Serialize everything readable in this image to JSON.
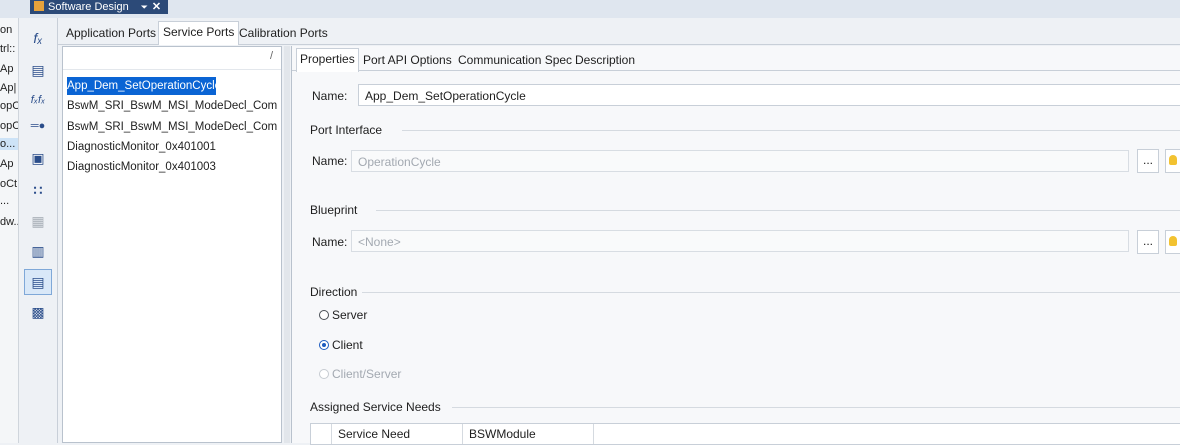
{
  "document_tab": {
    "title": "Software Design",
    "pin": "⏷",
    "close": "✕"
  },
  "left_tree": [
    {
      "text": "on"
    },
    {
      "text": "trl::"
    },
    {
      "text": "Ap"
    },
    {
      "text": "Ap|"
    },
    {
      "text": "opC"
    },
    {
      "text": "opC"
    },
    {
      "text": "o..."
    },
    {
      "text": "Ap"
    },
    {
      "text": "oCt"
    },
    {
      "text": "..."
    },
    {
      "text": "dw.."
    }
  ],
  "toolbar_icons": [
    {
      "name": "fx-icon",
      "glyph": "fₓ"
    },
    {
      "name": "save-component-icon",
      "glyph": "▤"
    },
    {
      "name": "fxfx-icon",
      "glyph": "fₓfₓ"
    },
    {
      "name": "connector-icon",
      "glyph": "═●"
    },
    {
      "name": "component-icon",
      "glyph": "▣"
    },
    {
      "name": "ports-icon",
      "glyph": "∷"
    },
    {
      "name": "disabled-component-icon",
      "glyph": "▦"
    },
    {
      "name": "runnable-icon",
      "glyph": "▥"
    },
    {
      "name": "service-component-icon",
      "glyph": "▤"
    },
    {
      "name": "module-icon",
      "glyph": "▩"
    }
  ],
  "tabs": {
    "application_ports": "Application Ports",
    "service_ports": "Service Ports",
    "calibration_ports": "Calibration Ports"
  },
  "list": {
    "header_mark": "/",
    "items": [
      {
        "label": "App_Dem_SetOperationCycle"
      },
      {
        "label": "BswM_SRI_BswM_MSI_ModeDecl_ComF..."
      },
      {
        "label": "BswM_SRI_BswM_MSI_ModeDecl_ComF..."
      },
      {
        "label": "DiagnosticMonitor_0x401001"
      },
      {
        "label": "DiagnosticMonitor_0x401003"
      }
    ]
  },
  "subtabs": {
    "properties": "Properties",
    "port_api_options": "Port API Options",
    "communication_spec": "Communication Spec",
    "description": "Description"
  },
  "properties": {
    "name_label": "Name:",
    "name_value": "App_Dem_SetOperationCycle",
    "port_interface": {
      "title": "Port Interface",
      "name_label": "Name:",
      "name_value": "OperationCycle",
      "browse": "..."
    },
    "blueprint": {
      "title": "Blueprint",
      "name_label": "Name:",
      "name_value": "<None>",
      "browse": "..."
    },
    "direction": {
      "title": "Direction",
      "options": [
        {
          "label": "Server"
        },
        {
          "label": "Client"
        },
        {
          "label": "Client/Server"
        }
      ]
    },
    "assigned_service_needs": {
      "title": "Assigned Service Needs",
      "columns": [
        {
          "label": "Service Need"
        },
        {
          "label": "BSWModule"
        }
      ]
    }
  },
  "colors": {
    "selection": "#0a64d4",
    "document_tab": "#2c4a78"
  }
}
